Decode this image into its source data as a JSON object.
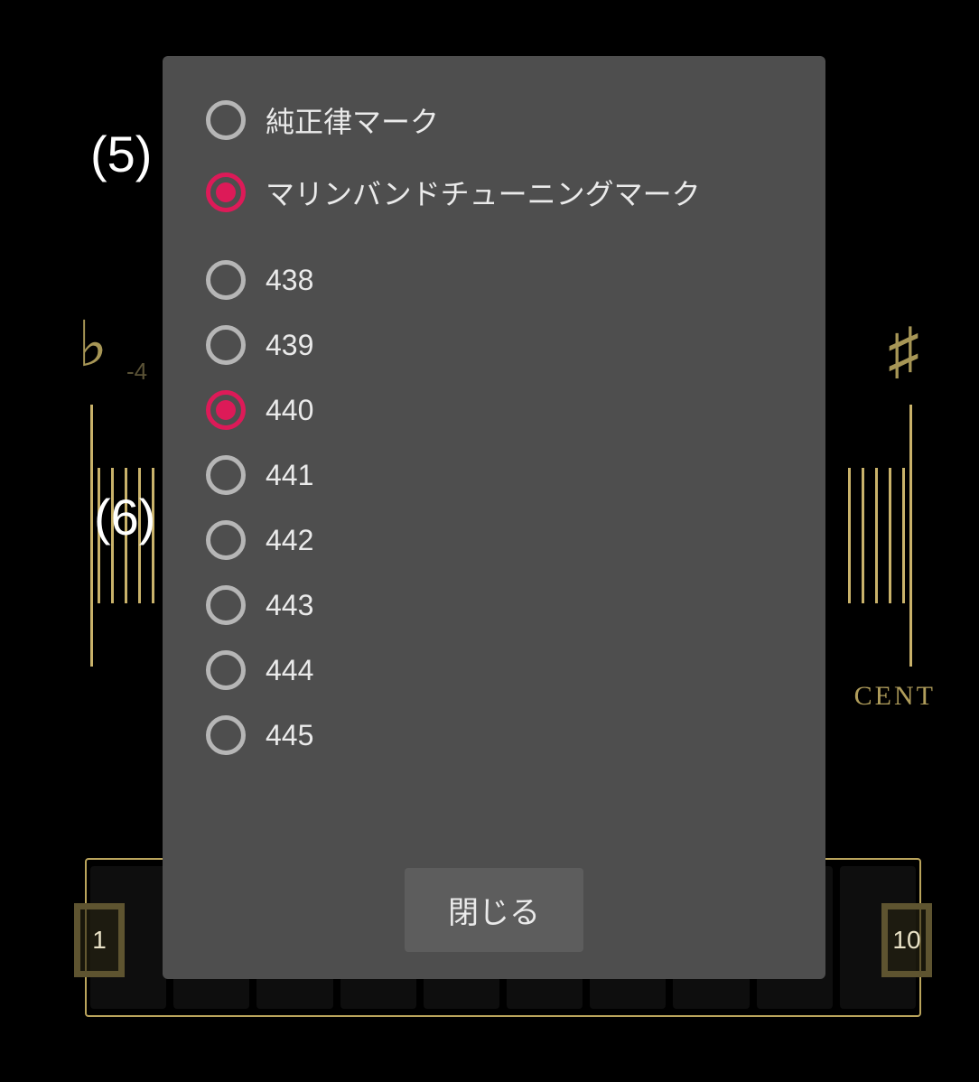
{
  "annotations": {
    "five": "(5)",
    "six": "(6)"
  },
  "background": {
    "flat_symbol": "♭",
    "sharp_symbol": "♯",
    "left_value": "-4",
    "cent_label": "CENT",
    "strip_left_number": "1",
    "strip_right_number": "10"
  },
  "modal": {
    "group1": {
      "selected_index": 1,
      "options": [
        {
          "label": "純正律マーク"
        },
        {
          "label": "マリンバンドチューニングマーク"
        }
      ]
    },
    "group2": {
      "selected_index": 2,
      "options": [
        {
          "label": "438"
        },
        {
          "label": "439"
        },
        {
          "label": "440"
        },
        {
          "label": "441"
        },
        {
          "label": "442"
        },
        {
          "label": "443"
        },
        {
          "label": "444"
        },
        {
          "label": "445"
        }
      ]
    },
    "close_label": "閉じる"
  },
  "colors": {
    "accent": "#dd1a58",
    "modal_bg": "#4e4e4e",
    "gold": "#c9b26a"
  }
}
